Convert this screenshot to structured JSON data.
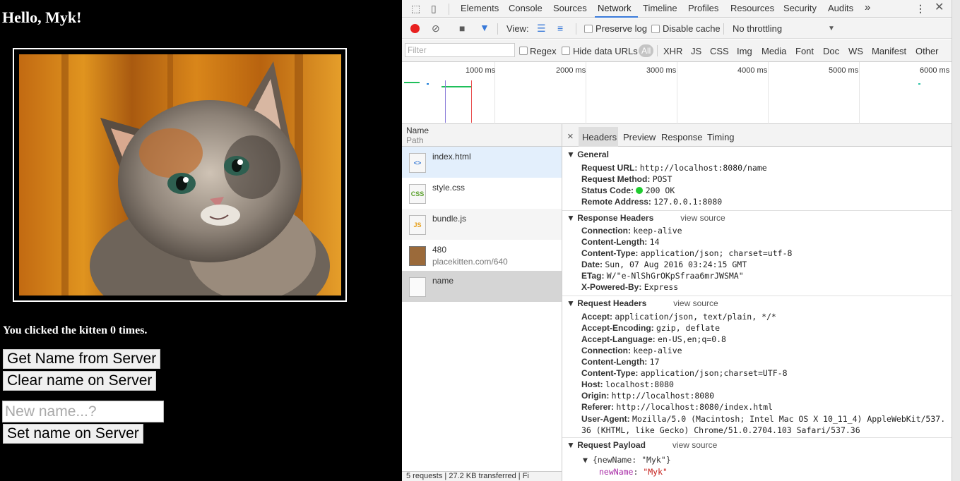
{
  "app": {
    "greeting": "Hello, Myk!",
    "click_message": "You clicked the kitten 0 times.",
    "get_name_button": "Get Name from Server",
    "clear_name_button": "Clear name on Server",
    "name_placeholder": "New name...?",
    "set_name_button": "Set name on Server"
  },
  "devtools": {
    "panel_tabs": [
      "Elements",
      "Console",
      "Sources",
      "Network",
      "Timeline",
      "Profiles",
      "Resources",
      "Security",
      "Audits"
    ],
    "active_panel": "Network",
    "more_tabs": "»",
    "toolbar": {
      "view_label": "View:",
      "preserve_log": "Preserve log",
      "disable_cache": "Disable cache",
      "throttling": "No throttling"
    },
    "filter": {
      "placeholder": "Filter",
      "regex": "Regex",
      "hide_data_urls": "Hide data URLs",
      "types": [
        "All",
        "XHR",
        "JS",
        "CSS",
        "Img",
        "Media",
        "Font",
        "Doc",
        "WS",
        "Manifest",
        "Other"
      ]
    },
    "timeline_ticks": [
      "1000 ms",
      "2000 ms",
      "3000 ms",
      "4000 ms",
      "5000 ms",
      "6000 ms"
    ],
    "request_list": {
      "col_name": "Name",
      "col_path": "Path",
      "requests": [
        {
          "name": "index.html",
          "path": "",
          "icon": "html-file-icon",
          "icon_text": "<>"
        },
        {
          "name": "style.css",
          "path": "",
          "icon": "css-file-icon",
          "icon_text": "CSS"
        },
        {
          "name": "bundle.js",
          "path": "",
          "icon": "js-file-icon",
          "icon_text": "JS"
        },
        {
          "name": "480",
          "path": "placekitten.com/640",
          "icon": "image-file-icon",
          "icon_text": ""
        },
        {
          "name": "name",
          "path": "",
          "icon": "blank-file-icon",
          "icon_text": ""
        }
      ],
      "status_summary": "5 requests | 27.2 KB transferred | Fi"
    },
    "detail_tabs": [
      "Headers",
      "Preview",
      "Response",
      "Timing"
    ],
    "active_detail_tab": "Headers",
    "close_glyph": "×",
    "sections": {
      "general": "General",
      "response_headers": "Response Headers",
      "request_headers": "Request Headers",
      "request_payload": "Request Payload",
      "view_source": "view source"
    },
    "general": [
      {
        "k": "Request URL:",
        "v": "http://localhost:8080/name"
      },
      {
        "k": "Request Method:",
        "v": "POST"
      },
      {
        "k": "Status Code:",
        "v": "200 OK"
      },
      {
        "k": "Remote Address:",
        "v": "127.0.0.1:8080"
      }
    ],
    "status_color": "#1fcc2f",
    "response_headers": [
      {
        "k": "Connection:",
        "v": "keep-alive"
      },
      {
        "k": "Content-Length:",
        "v": "14"
      },
      {
        "k": "Content-Type:",
        "v": "application/json; charset=utf-8"
      },
      {
        "k": "Date:",
        "v": "Sun, 07 Aug 2016 03:24:15 GMT"
      },
      {
        "k": "ETag:",
        "v": "W/\"e-NlShGrOKpSfraa6mrJWSMA\""
      },
      {
        "k": "X-Powered-By:",
        "v": "Express"
      }
    ],
    "request_headers": [
      {
        "k": "Accept:",
        "v": "application/json, text/plain, */*"
      },
      {
        "k": "Accept-Encoding:",
        "v": "gzip, deflate"
      },
      {
        "k": "Accept-Language:",
        "v": "en-US,en;q=0.8"
      },
      {
        "k": "Connection:",
        "v": "keep-alive"
      },
      {
        "k": "Content-Length:",
        "v": "17"
      },
      {
        "k": "Content-Type:",
        "v": "application/json;charset=UTF-8"
      },
      {
        "k": "Host:",
        "v": "localhost:8080"
      },
      {
        "k": "Origin:",
        "v": "http://localhost:8080"
      },
      {
        "k": "Referer:",
        "v": "http://localhost:8080/index.html"
      },
      {
        "k": "User-Agent:",
        "v": "Mozilla/5.0 (Macintosh; Intel Mac OS X 10_11_4) AppleWebKit/537.36 (KHTML, like Gecko) Chrome/51.0.2704.103 Safari/537.36"
      }
    ],
    "payload": {
      "summary": "{newName: \"Myk\"}",
      "key": "newName",
      "value": "\"Myk\""
    }
  }
}
